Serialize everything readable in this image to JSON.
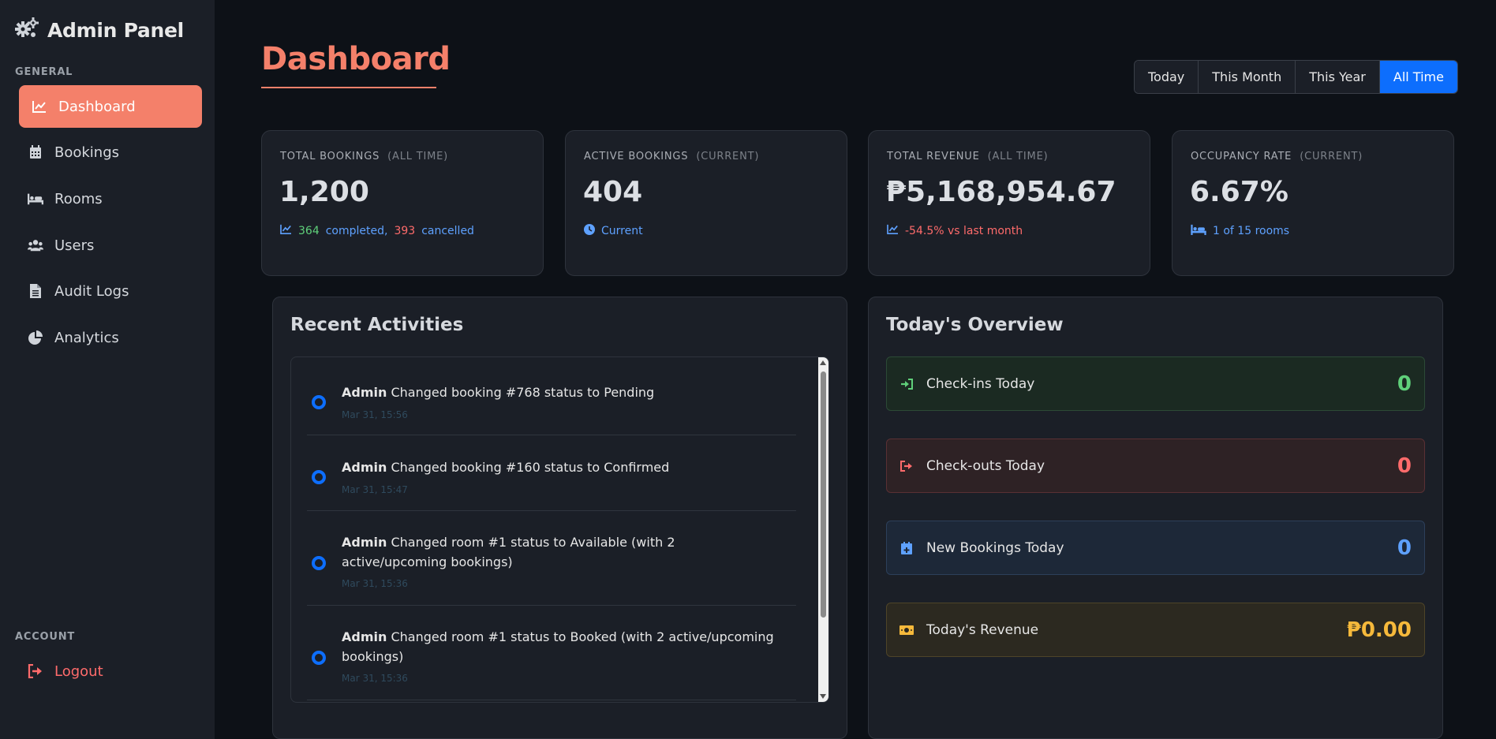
{
  "sidebar": {
    "brand": "Admin Panel",
    "general_label": "GENERAL",
    "account_label": "ACCOUNT",
    "items": [
      {
        "label": "Dashboard"
      },
      {
        "label": "Bookings"
      },
      {
        "label": "Rooms"
      },
      {
        "label": "Users"
      },
      {
        "label": "Audit Logs"
      },
      {
        "label": "Analytics"
      }
    ],
    "logout": "Logout"
  },
  "header": {
    "title": "Dashboard",
    "periods": [
      "Today",
      "This Month",
      "This Year",
      "All Time"
    ],
    "active_period": "All Time"
  },
  "stats": [
    {
      "label": "TOTAL BOOKINGS",
      "sub": "(ALL TIME)",
      "value": "1,200",
      "completed": "364",
      "completed_label": "completed,",
      "cancelled": "393",
      "cancelled_label": "cancelled"
    },
    {
      "label": "ACTIVE BOOKINGS",
      "sub": "(CURRENT)",
      "value": "404",
      "foot": "Current"
    },
    {
      "label": "TOTAL REVENUE",
      "sub": "(ALL TIME)",
      "value": "₱5,168,954.67",
      "foot": "-54.5% vs last month"
    },
    {
      "label": "OCCUPANCY RATE",
      "sub": "(CURRENT)",
      "value": "6.67%",
      "foot": "1 of 15 rooms"
    }
  ],
  "activities": {
    "title": "Recent Activities",
    "items": [
      {
        "actor": "Admin",
        "text": "Changed booking #768 status to Pending",
        "time": "Mar 31, 15:56"
      },
      {
        "actor": "Admin",
        "text": "Changed booking #160 status to Confirmed",
        "time": "Mar 31, 15:47"
      },
      {
        "actor": "Admin",
        "text": "Changed room #1 status to Available (with 2 active/upcoming bookings)",
        "time": "Mar 31, 15:36"
      },
      {
        "actor": "Admin",
        "text": "Changed room #1 status to Booked (with 2 active/upcoming bookings)",
        "time": "Mar 31, 15:36"
      }
    ]
  },
  "overview": {
    "title": "Today's Overview",
    "items": [
      {
        "label": "Check-ins Today",
        "value": "0",
        "color": "#5fd07a"
      },
      {
        "label": "Check-outs Today",
        "value": "0",
        "color": "#ff6b6b"
      },
      {
        "label": "New Bookings Today",
        "value": "0",
        "color": "#5ea1ff"
      },
      {
        "label": "Today's Revenue",
        "value": "₱0.00",
        "color": "#f6b93b"
      }
    ]
  },
  "colors": {
    "accent": "#f4806a",
    "primary": "#0d6efd",
    "bg": "#0d1117",
    "panel": "#1b1f27"
  }
}
